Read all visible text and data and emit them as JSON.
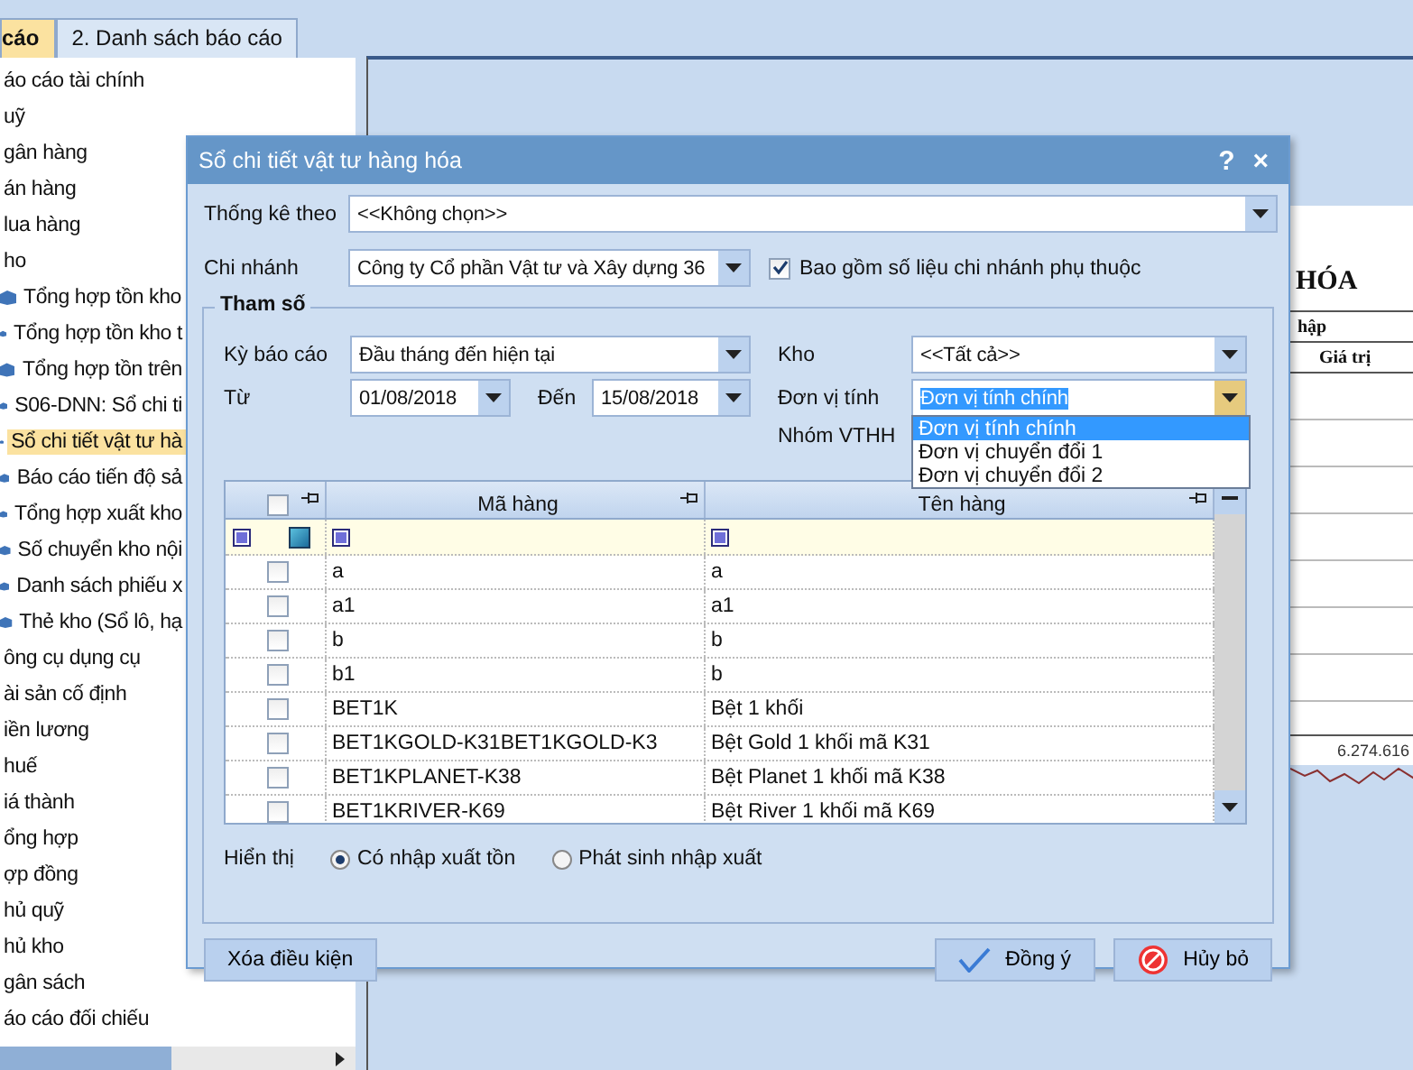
{
  "left_panel": {
    "tabs": [
      {
        "label": "cáo",
        "selected": true
      },
      {
        "label": "2. Danh sách báo cáo",
        "selected": false
      }
    ],
    "tree": [
      {
        "label": "áo cáo tài chính",
        "selected": false
      },
      {
        "label": "uỹ",
        "selected": false
      },
      {
        "label": "gân hàng",
        "selected": false
      },
      {
        "label": "án hàng",
        "selected": false
      },
      {
        "label": "lua hàng",
        "selected": false
      },
      {
        "label": "ho",
        "selected": false,
        "children": [
          {
            "label": "Tổng hợp tồn kho",
            "selected": false
          },
          {
            "label": "Tổng hợp tồn kho t",
            "selected": false
          },
          {
            "label": "Tổng hợp tồn trên",
            "selected": false
          },
          {
            "label": "S06-DNN: Sổ chi ti",
            "selected": false
          },
          {
            "label": "Sổ chi tiết vật tư hà",
            "selected": true
          },
          {
            "label": "Báo cáo tiến độ sả",
            "selected": false
          },
          {
            "label": "Tổng hợp xuất kho",
            "selected": false
          },
          {
            "label": "Số chuyển kho nội",
            "selected": false
          },
          {
            "label": "Danh sách phiếu x",
            "selected": false
          },
          {
            "label": "Thẻ kho (Sổ lô, hạ",
            "selected": false
          }
        ]
      },
      {
        "label": "ông cụ dụng cụ",
        "selected": false
      },
      {
        "label": "ài sản cố định",
        "selected": false
      },
      {
        "label": "iền lương",
        "selected": false
      },
      {
        "label": "huế",
        "selected": false
      },
      {
        "label": "iá thành",
        "selected": false
      },
      {
        "label": "ổng hợp",
        "selected": false
      },
      {
        "label": "ợp đồng",
        "selected": false
      },
      {
        "label": "hủ quỹ",
        "selected": false
      },
      {
        "label": "hủ kho",
        "selected": false
      },
      {
        "label": "gân sách",
        "selected": false
      },
      {
        "label": "áo cáo đối chiếu",
        "selected": false
      }
    ]
  },
  "report_preview": {
    "title": "HÓA",
    "column_header": "hập",
    "subheader": "Giá trị",
    "total": "6.274.616"
  },
  "dialog": {
    "title": "Sổ chi tiết vật tư hàng hóa",
    "help": "?",
    "close": "×",
    "statistic_by": {
      "label": "Thống kê theo",
      "value": "<<Không chọn>>"
    },
    "branch": {
      "label": "Chi nhánh",
      "value": "Công ty Cổ phần Vật tư và Xây dựng 36"
    },
    "include_dependent": {
      "label": "Bao gồm số liệu chi nhánh phụ thuộc",
      "checked": true
    },
    "parameters": {
      "title": "Tham số",
      "period": {
        "label": "Kỳ báo cáo",
        "value": "Đầu tháng đến hiện tại"
      },
      "warehouse": {
        "label": "Kho",
        "value": "<<Tất cả>>"
      },
      "from": {
        "label": "Từ",
        "value": "01/08/2018"
      },
      "to": {
        "label": "Đến",
        "value": "15/08/2018"
      },
      "unit": {
        "label": "Đơn vị tính",
        "value": "Đơn vị tính chính",
        "open": true,
        "options": [
          {
            "label": "Đơn vị tính chính",
            "selected": true
          },
          {
            "label": "Đơn vị chuyển đổi 1",
            "selected": false
          },
          {
            "label": "Đơn vị chuyển đổi 2",
            "selected": false
          }
        ]
      },
      "group_label": "Nhóm VTHH",
      "grid": {
        "all_checked": false,
        "columns": [
          "Mã hàng",
          "Tên hàng"
        ],
        "rows": [
          {
            "code": "a",
            "name": "a",
            "checked": false
          },
          {
            "code": "a1",
            "name": "a1",
            "checked": false
          },
          {
            "code": "b",
            "name": "b",
            "checked": false
          },
          {
            "code": "b1",
            "name": "b",
            "checked": false
          },
          {
            "code": "BET1K",
            "name": "Bệt 1 khối",
            "checked": false
          },
          {
            "code": "BET1KGOLD-K31BET1KGOLD-K3",
            "name": "Bệt Gold 1 khối mã K31",
            "checked": false
          },
          {
            "code": "BET1KPLANET-K38",
            "name": "Bệt Planet 1 khối mã K38",
            "checked": false
          },
          {
            "code": "BET1KRIVER-K69",
            "name": "Bệt River 1 khối mã K69",
            "checked": false
          }
        ]
      },
      "display": {
        "label": "Hiển thị",
        "options": [
          {
            "label": "Có nhập xuất tồn",
            "selected": true
          },
          {
            "label": "Phát sinh nhập xuất",
            "selected": false
          }
        ]
      }
    },
    "buttons": [
      {
        "label": "Xóa điều kiện",
        "kind": "clear"
      },
      {
        "label": "Đồng ý",
        "kind": "ok"
      },
      {
        "label": "Hủy bỏ",
        "kind": "cancel"
      }
    ]
  }
}
